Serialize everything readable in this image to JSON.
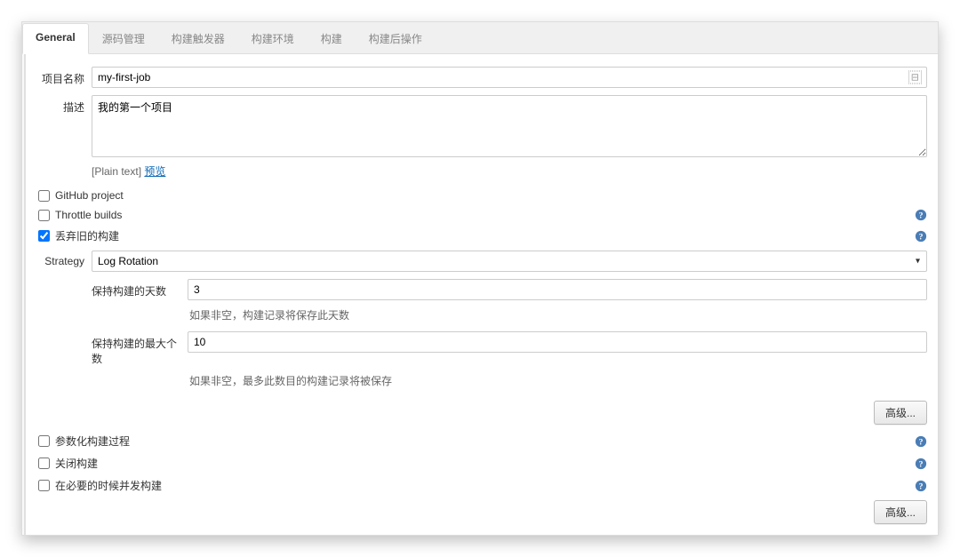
{
  "tabs": {
    "general": "General",
    "scm": "源码管理",
    "triggers": "构建触发器",
    "env": "构建环境",
    "build": "构建",
    "post": "构建后操作"
  },
  "labels": {
    "projectName": "项目名称",
    "description": "描述",
    "plaintext": "[Plain text]",
    "preview": "预览",
    "strategy": "Strategy"
  },
  "projectName": "my-first-job",
  "description": "我的第一个项目",
  "checkboxes": {
    "github": "GitHub project",
    "throttle": "Throttle builds",
    "discard": "丢弃旧的构建",
    "parameterized": "参数化构建过程",
    "disable": "关闭构建",
    "concurrent": "在必要的时候并发构建"
  },
  "strategy": {
    "selected": "Log Rotation",
    "days": {
      "label": "保持构建的天数",
      "value": "3",
      "hint": "如果非空，构建记录将保存此天数"
    },
    "max": {
      "label": "保持构建的最大个数",
      "value": "10",
      "hint": "如果非空，最多此数目的构建记录将被保存"
    }
  },
  "buttons": {
    "advanced": "高级..."
  }
}
